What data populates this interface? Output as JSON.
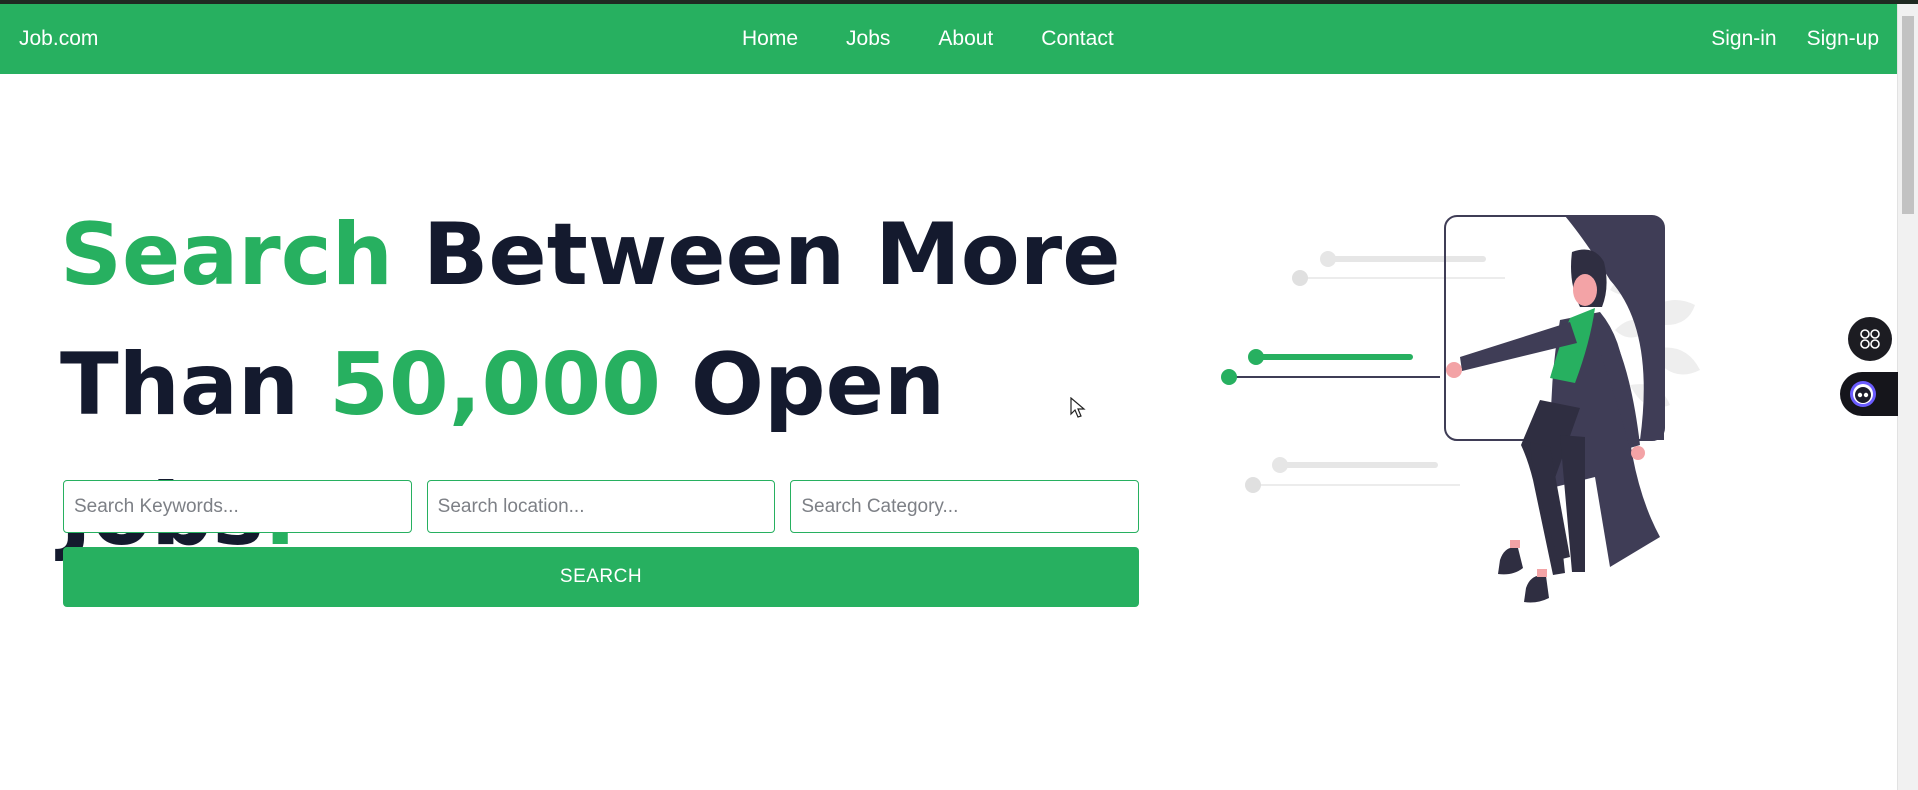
{
  "nav": {
    "brand": "Job.com",
    "links": [
      "Home",
      "Jobs",
      "About",
      "Contact"
    ],
    "auth": [
      "Sign-in",
      "Sign-up"
    ]
  },
  "hero": {
    "line1_highlight": "Search",
    "line1_rest": " Between More",
    "line2_start": "Than ",
    "line2_highlight": "50,000",
    "line2_rest": " Open Jobs",
    "line2_dot": "."
  },
  "search": {
    "keywords_placeholder": "Search Keywords...",
    "location_placeholder": "Search location...",
    "category_placeholder": "Search Category...",
    "button_label": "SEARCH"
  },
  "colors": {
    "brand_green": "#27b060",
    "heading_dark": "#141a2e"
  },
  "icons": {
    "apps": "apps-icon",
    "assistant": "assistant-icon",
    "cursor": "mouse-cursor-icon"
  }
}
